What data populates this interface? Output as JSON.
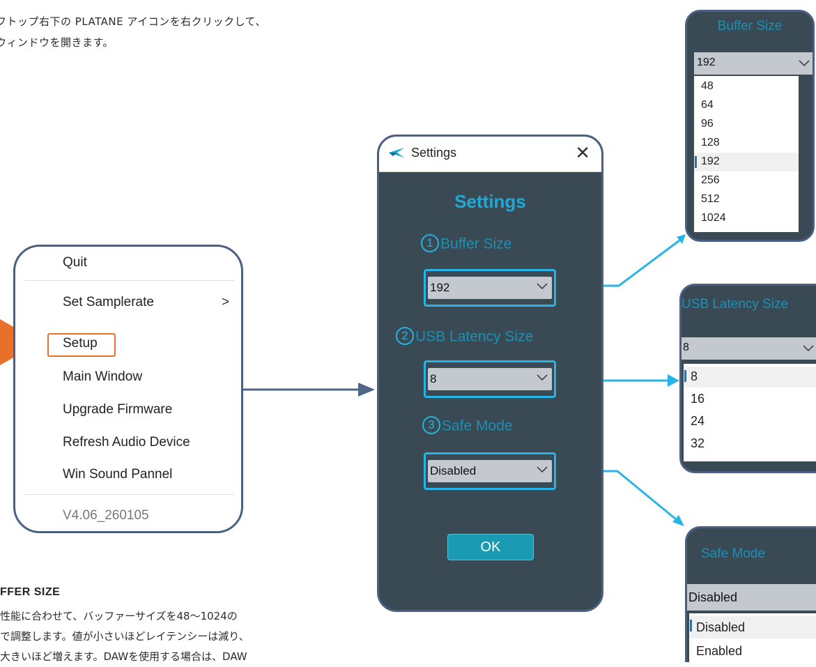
{
  "intro": {
    "line1": "フトップ右下の PLATANE アイコンを右クリックして、",
    "line2": "ウィンドウを開きます。"
  },
  "context_menu": {
    "items": [
      {
        "label": "Quit"
      },
      {
        "label": "Set Samplerate"
      },
      {
        "label": "Setup"
      },
      {
        "label": "Main Window"
      },
      {
        "label": "Upgrade Firmware"
      },
      {
        "label": "Refresh Audio Device"
      },
      {
        "label": "Win Sound Pannel"
      }
    ],
    "submenu_glyph": ">",
    "version": "V4.06_260105",
    "highlighted": "Setup"
  },
  "settings_window": {
    "title": "Settings",
    "close": "✕",
    "heading": "Settings",
    "fields": [
      {
        "number": "1",
        "label": "Buffer Size",
        "value": "192"
      },
      {
        "number": "2",
        "label": "USB Latency Size",
        "value": "8"
      },
      {
        "number": "3",
        "label": "Safe Mode",
        "value": "Disabled"
      }
    ],
    "ok_label": "OK"
  },
  "popups": {
    "buffer_size": {
      "title": "Buffer Size",
      "value": "192",
      "options": [
        "48",
        "64",
        "96",
        "128",
        "192",
        "256",
        "512",
        "1024"
      ],
      "selected": "192"
    },
    "usb_latency": {
      "title": "USB Latency Size",
      "value": "8",
      "options": [
        "8",
        "16",
        "24",
        "32"
      ],
      "selected": "8"
    },
    "safe_mode": {
      "title": "Safe Mode",
      "value": "Disabled",
      "options": [
        "Disabled",
        "Enabled"
      ],
      "selected": "Disabled"
    }
  },
  "buffer_section": {
    "heading": "FFER SIZE",
    "line1": "性能に合わせて、バッファーサイズを48〜1024の",
    "line2": "で調整します。値が小さいほどレイテンシーは減り、",
    "line3": "大きいほど増えます。DAWを使用する場合は、DAW"
  },
  "colors": {
    "accent_blue": "#27b4e6",
    "frame": "#4a5f82",
    "panel": "#3a4a55",
    "highlight_orange": "#e8702b",
    "ok_button": "#1a9bb3"
  }
}
